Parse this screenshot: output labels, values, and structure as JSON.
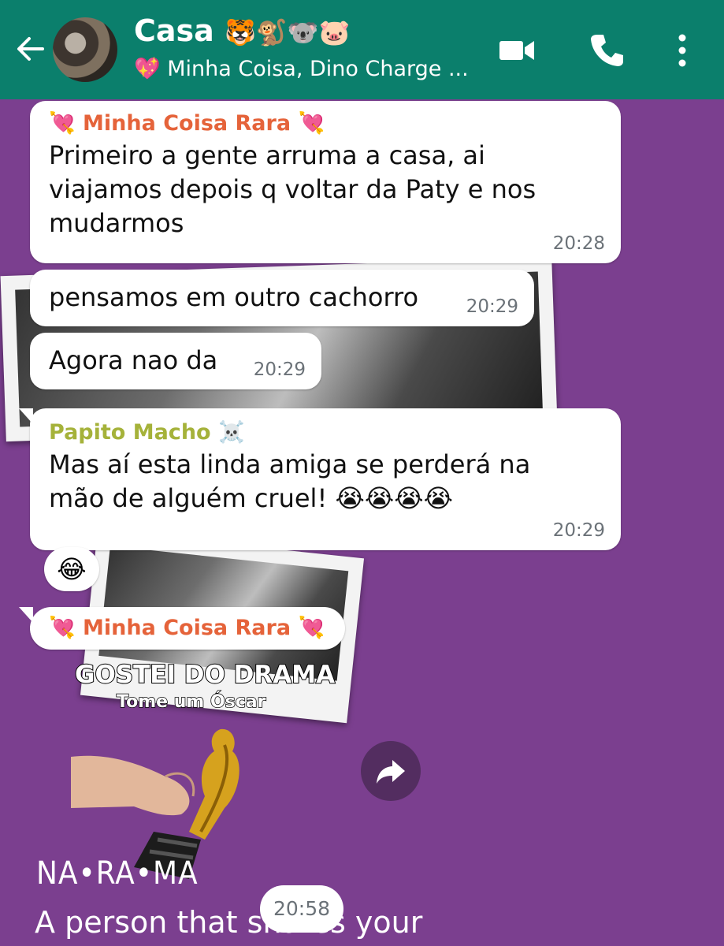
{
  "header": {
    "title": "Casa",
    "title_emojis": "🐯🐒🐨🐷",
    "subtitle": "💖 Minha Coisa, Dino Charge ...",
    "color": "#0b7f6c"
  },
  "messages": [
    {
      "sender": "💘 Minha Coisa Rara 💘",
      "sender_color": "#e5633a",
      "text": "Primeiro a gente arruma a casa, ai viajamos depois q voltar da Paty e nos mudarmos",
      "time": "20:28"
    },
    {
      "text": "pensamos em outro cachorro",
      "time": "20:29"
    },
    {
      "text": "Agora nao da",
      "time": "20:29"
    },
    {
      "sender": "Papito Macho ☠️",
      "sender_color": "#a5b23a",
      "text": "Mas aí esta linda amiga se perderá na mão de alguém cruel! 😭😭😭😭",
      "time": "20:29",
      "reaction": "😂"
    },
    {
      "sender": "💘 Minha Coisa Rara 💘",
      "sender_color": "#e5633a",
      "sticker": {
        "line1": "GOSTEI DO DRAMA",
        "line2": "Tome um Óscar"
      },
      "time": "20:58"
    }
  ],
  "wallpaper": {
    "brand": "NA•RA•MA",
    "tagline": "A person that shares your"
  },
  "icons": {
    "back": "arrow-left-icon",
    "video": "video-call-icon",
    "phone": "phone-icon",
    "menu": "more-vert-icon",
    "forward": "forward-icon"
  },
  "colors": {
    "background": "#7b3f8f",
    "bubble": "#ffffff"
  }
}
